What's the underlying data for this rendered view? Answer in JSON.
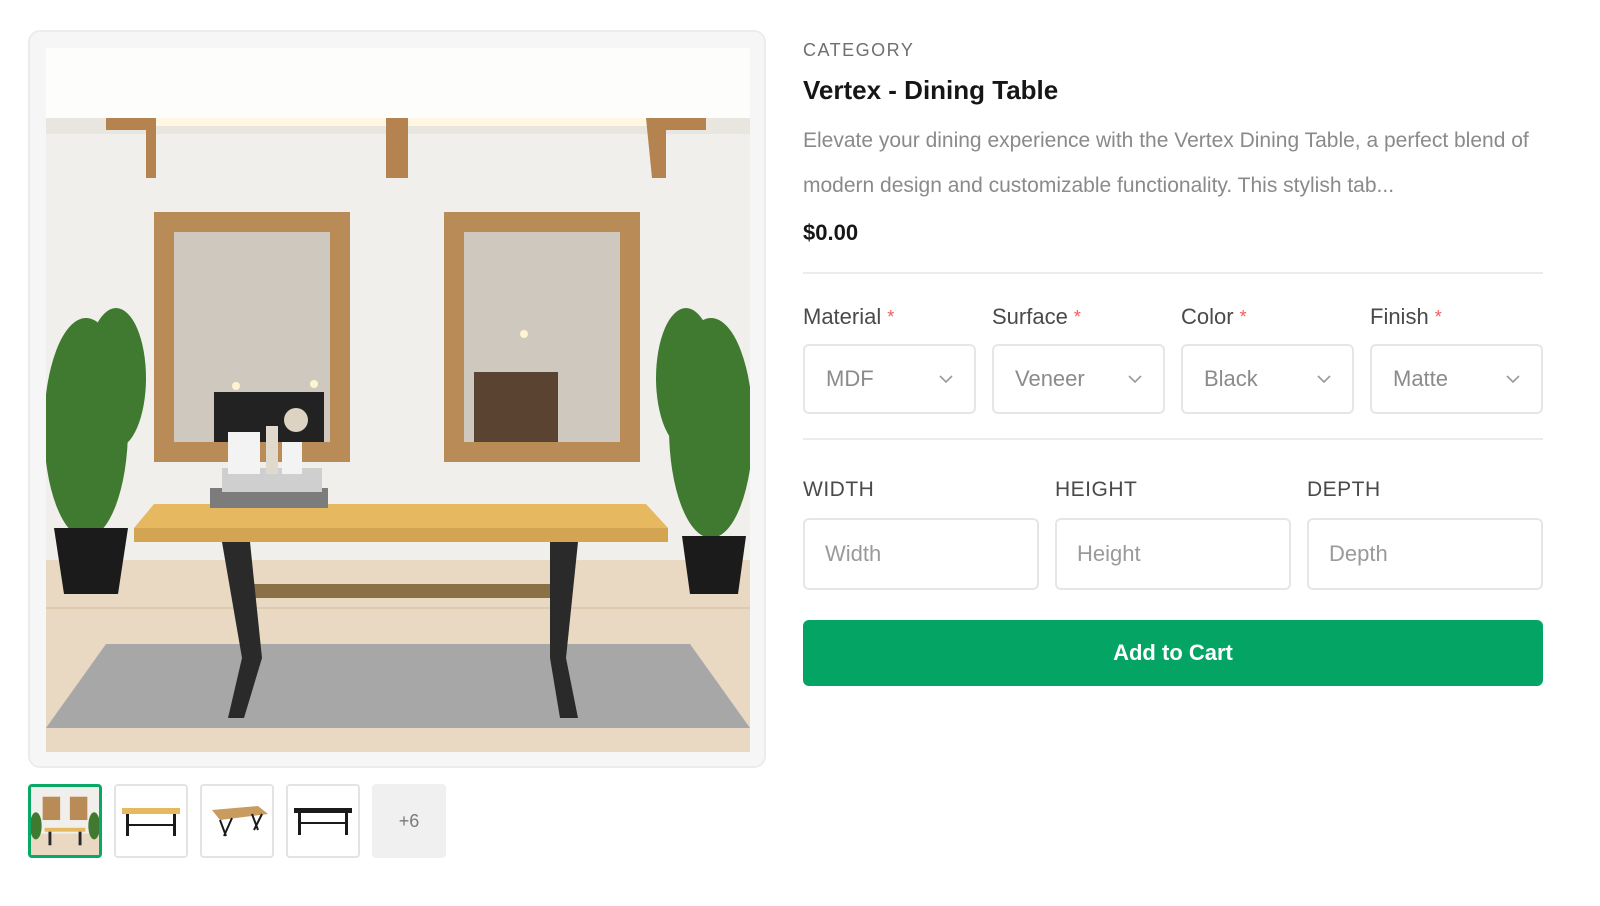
{
  "gallery": {
    "main_image_alt": "Dining table in a room with mirrors and plants",
    "thumbnails": [
      {
        "name": "thumb-room-scene",
        "active": true
      },
      {
        "name": "thumb-table-side",
        "active": false
      },
      {
        "name": "thumb-table-angled",
        "active": false
      },
      {
        "name": "thumb-table-black",
        "active": false
      }
    ],
    "more_label": "+6"
  },
  "product": {
    "category": "CATEGORY",
    "title": "Vertex - Dining Table",
    "description": "Elevate your dining experience with the Vertex Dining Table, a perfect blend of modern design and customizable functionality. This stylish tab...",
    "price": "$0.00"
  },
  "options": [
    {
      "label": "Material",
      "required_mark": "*",
      "value": "MDF"
    },
    {
      "label": "Surface",
      "required_mark": "*",
      "value": "Veneer"
    },
    {
      "label": "Color",
      "required_mark": "*",
      "value": "Black"
    },
    {
      "label": "Finish",
      "required_mark": "*",
      "value": "Matte"
    }
  ],
  "dimensions": [
    {
      "label": "WIDTH",
      "placeholder": "Width"
    },
    {
      "label": "HEIGHT",
      "placeholder": "Height"
    },
    {
      "label": "DEPTH",
      "placeholder": "Depth"
    }
  ],
  "cta": {
    "add_to_cart_label": "Add to Cart"
  },
  "colors": {
    "accent": "#04a464",
    "active_thumb_border": "#0aa865",
    "required": "#f25c5c",
    "border": "#e6e6e6"
  }
}
